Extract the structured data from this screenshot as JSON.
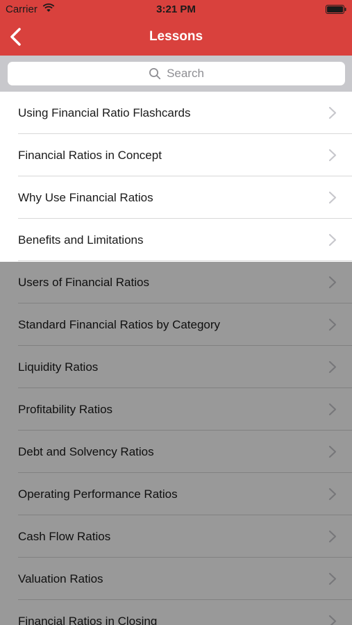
{
  "status_bar": {
    "carrier": "Carrier",
    "time": "3:21 PM",
    "wifi_icon": "wifi-icon",
    "battery_icon": "battery-icon"
  },
  "nav_bar": {
    "title": "Lessons",
    "back_icon": "chevron-left-icon",
    "background_color": "#d9413d"
  },
  "search": {
    "placeholder": "Search",
    "icon": "magnifier-icon"
  },
  "lessons": [
    {
      "label": "Using Financial Ratio Flashcards"
    },
    {
      "label": "Financial Ratios in Concept"
    },
    {
      "label": "Why Use Financial Ratios"
    },
    {
      "label": "Benefits and Limitations"
    },
    {
      "label": "Users of Financial Ratios"
    },
    {
      "label": "Standard Financial Ratios by Category"
    },
    {
      "label": "Liquidity Ratios"
    },
    {
      "label": "Profitability Ratios"
    },
    {
      "label": "Debt and Solvency Ratios"
    },
    {
      "label": "Operating Performance Ratios"
    },
    {
      "label": "Cash Flow Ratios"
    },
    {
      "label": "Valuation Ratios"
    },
    {
      "label": "Financial Ratios in Closing"
    }
  ],
  "overlay": {
    "color": "rgba(0,0,0,0.40)"
  }
}
